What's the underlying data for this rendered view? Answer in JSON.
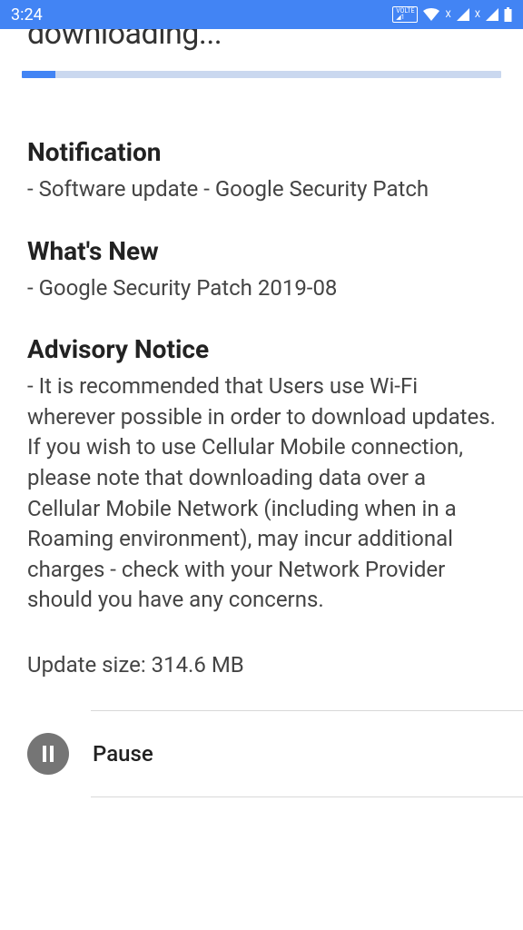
{
  "status_bar": {
    "time": "3:24"
  },
  "header": {
    "title_partial": "downloading..."
  },
  "progress": {
    "percent": 7
  },
  "sections": {
    "notification": {
      "heading": "Notification",
      "text": "- Software update - Google Security Patch"
    },
    "whats_new": {
      "heading": "What's New",
      "text": "- Google Security Patch 2019-08"
    },
    "advisory": {
      "heading": "Advisory Notice",
      "text": "- It is recommended that Users use Wi-Fi wherever possible in order to download updates. If you wish to use Cellular Mobile connection, please note that downloading data over a Cellular Mobile Network (including when in a Roaming environment), may incur additional charges - check with your Network Provider should you have any concerns."
    }
  },
  "update_size": {
    "label": "Update size: 314.6 MB"
  },
  "actions": {
    "pause_label": "Pause"
  }
}
